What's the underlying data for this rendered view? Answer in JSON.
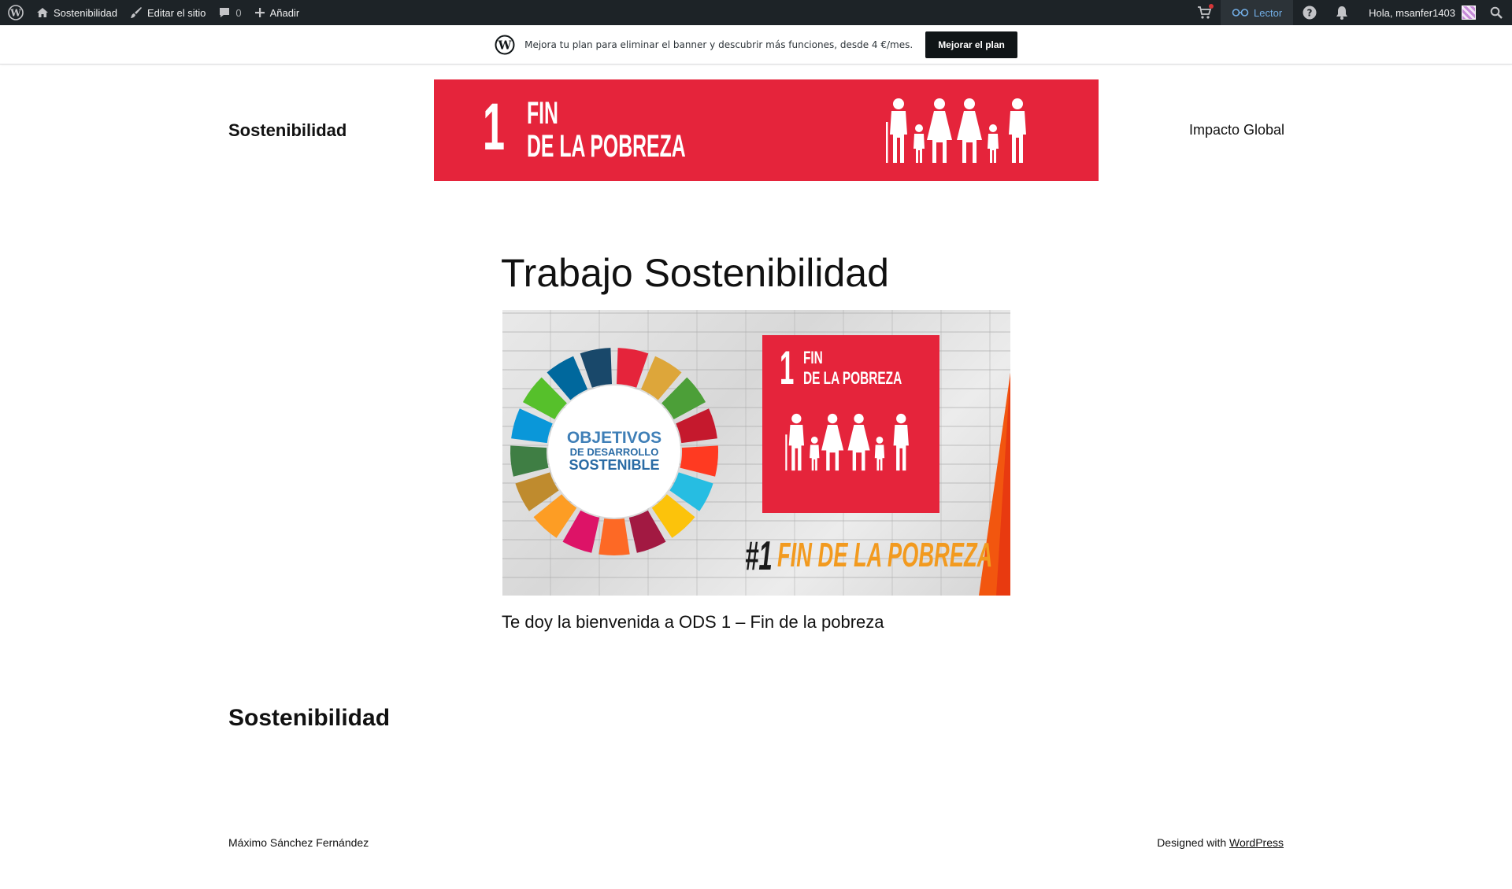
{
  "admin_bar": {
    "site_name": "Sostenibilidad",
    "edit_site": "Editar el sitio",
    "comments_count": "0",
    "add_new": "Añadir",
    "reader": "Lector",
    "greeting": "Hola, msanfer1403",
    "icons": [
      "wordpress-icon",
      "home-icon",
      "brush-icon",
      "comment-icon",
      "plus-icon",
      "cart-icon",
      "reader-icon",
      "help-icon",
      "bell-icon",
      "avatar",
      "search-icon"
    ]
  },
  "upgrade_banner": {
    "text": "Mejora tu plan para eliminar el banner y descubrir más funciones, desde 4 €/mes.",
    "button": "Mejorar el plan"
  },
  "header": {
    "site_title": "Sostenibilidad",
    "banner_number": "1",
    "banner_line1": "FIN",
    "banner_line2": "DE LA POBREZA",
    "banner_color": "#e5243b",
    "nav_link": "Impacto Global"
  },
  "post": {
    "title": "Trabajo Sostenibilidad",
    "image": {
      "wheel_line1": "OBJETIVOS",
      "wheel_line2": "DE DESARROLLO",
      "wheel_line3": "SOSTENIBLE",
      "square_number": "1",
      "square_line1": "FIN",
      "square_line2": "DE LA POBREZA",
      "caption_number": "#1",
      "caption_text": "FIN DE LA POBREZA"
    },
    "welcome": "Te doy la bienvenida a ODS 1 – Fin de la pobreza"
  },
  "footer": {
    "title": "Sostenibilidad",
    "author": "Máximo Sánchez Fernández",
    "designed_with": "Designed with",
    "wordpress_link": "WordPress"
  }
}
